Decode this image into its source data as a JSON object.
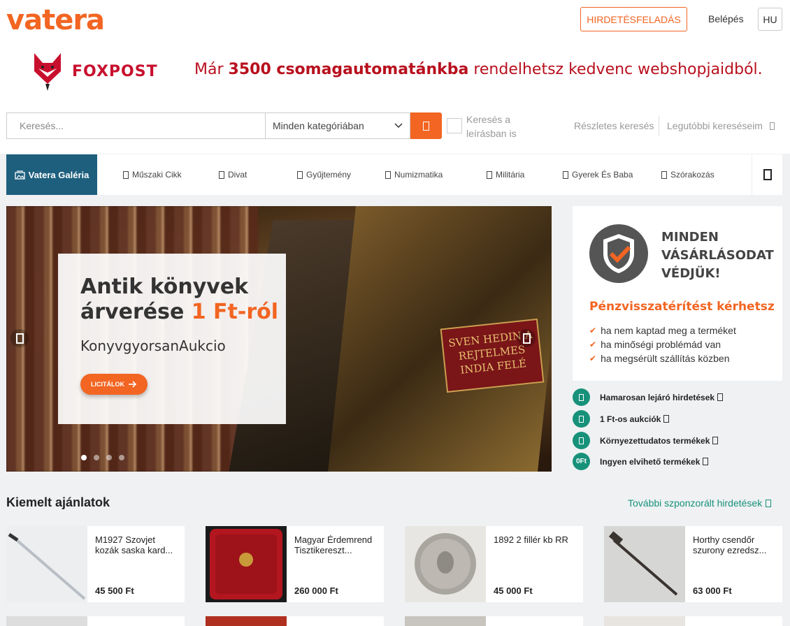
{
  "header": {
    "logo": "vatera",
    "post_ad": "HIRDETÉSFELADÁS",
    "login": "Belépés",
    "lang": "HU"
  },
  "banner": {
    "brand": "FOXPOST",
    "msg_pre": "Már ",
    "msg_bold": "3500 csomagautomatánkba",
    "msg_post": " rendelhetsz kedvenc webshopjaidból."
  },
  "search": {
    "placeholder": "Keresés...",
    "category": "Minden kategóriában",
    "desc_label": "Keresés a leírásban is",
    "advanced": "Részletes keresés",
    "recent": "Legutóbbi kereséseim"
  },
  "nav": {
    "gallery": "Vatera Galéria",
    "items": [
      "Műszaki Cikk",
      "Divat",
      "Gyűjtemény",
      "Numizmatika",
      "Militária",
      "Gyerek És Baba",
      "Szórakozás"
    ]
  },
  "hero": {
    "title1": "Antik könyvek",
    "title2_pre": "árverése ",
    "title2_hl": "1 Ft-ról",
    "subtitle": "KonyvgyorsanAukcio",
    "button": "LICITÁLOK",
    "book_label": "SVEN HEDIN A REJTELMES INDIA FELÉ"
  },
  "protection": {
    "title": "MINDEN VÁSÁRLÁSODAT VÉDJÜK!",
    "subtitle": "Pénzvisszatérítést kérhetsz",
    "items": [
      "ha nem kaptad meg a terméket",
      "ha minőségi problémád van",
      "ha megsérült szállítás közben"
    ]
  },
  "quick_links": [
    {
      "label": "Hamarosan lejáró hirdetések",
      "badge": ""
    },
    {
      "label": "1 Ft-os aukciók",
      "badge": ""
    },
    {
      "label": "Környezettudatos termékek",
      "badge": ""
    },
    {
      "label": "Ingyen elvihető termékek",
      "badge": "0Ft"
    }
  ],
  "featured": {
    "title": "Kiemelt ajánlatok",
    "more": "További szponzorált hirdetések",
    "items": [
      {
        "name": "M1927 Szovjet kozák saska kard...",
        "price": "45 500 Ft"
      },
      {
        "name": "Magyar Érdemrend Tisztikereszt...",
        "price": "260 000 Ft"
      },
      {
        "name": "1892 2 fillér kb RR",
        "price": "45 000 Ft"
      },
      {
        "name": "Horthy csendőr szurony ezredsz...",
        "price": "63 000 Ft"
      }
    ]
  },
  "colors": {
    "brand": "#f26522",
    "nav_active": "#1e5f7e",
    "accent_green": "#17917a",
    "foxpost_red": "#c8102e"
  }
}
